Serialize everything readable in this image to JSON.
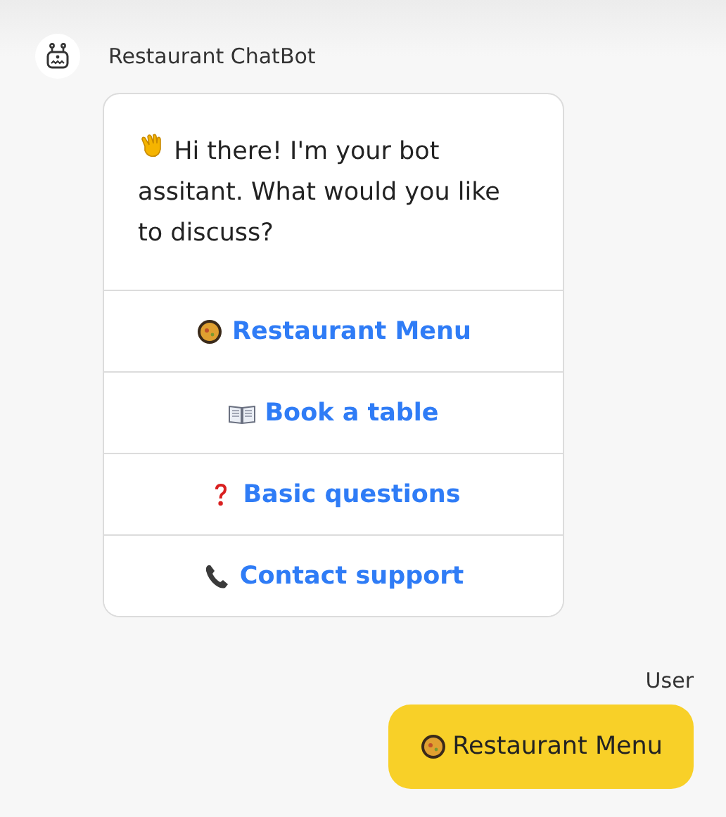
{
  "bot": {
    "name": "Restaurant ChatBot"
  },
  "bot_message": {
    "kind": "wave",
    "text": "Hi there! I'm your bot assitant. What would you like to discuss?"
  },
  "options": [
    {
      "kind": "pan",
      "label": "Restaurant Menu"
    },
    {
      "kind": "book",
      "label": "Book a table"
    },
    {
      "kind": "question",
      "label": "Basic questions"
    },
    {
      "kind": "phone",
      "label": "Contact support"
    }
  ],
  "user": {
    "name": "User"
  },
  "user_message": {
    "kind": "pan",
    "text": "Restaurant Menu"
  }
}
